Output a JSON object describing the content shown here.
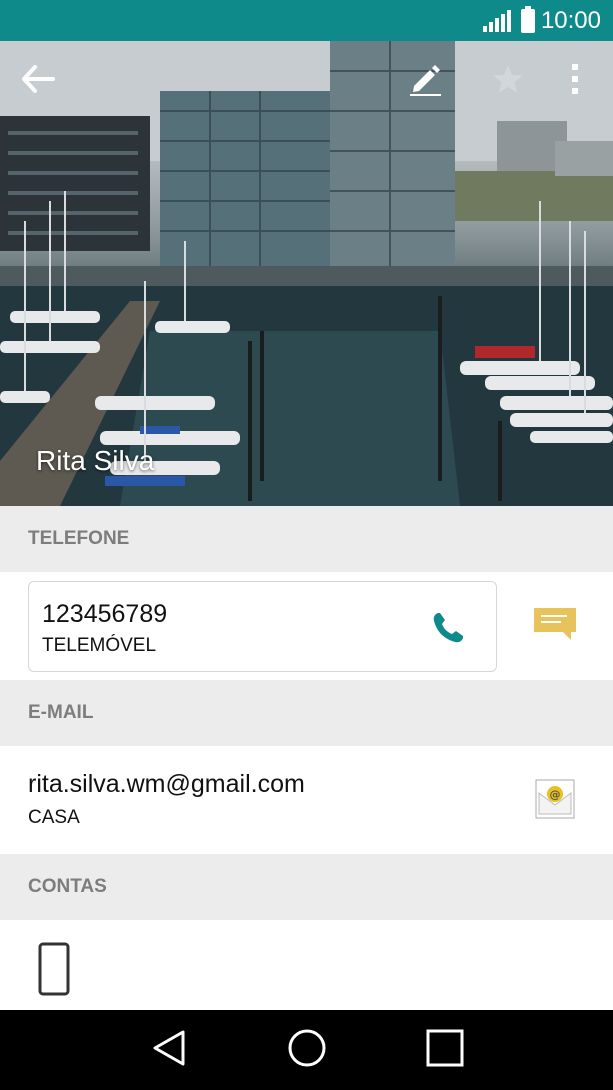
{
  "status_bar": {
    "time": "10:00"
  },
  "contact": {
    "name": "Rita Silva"
  },
  "sections": {
    "phone_header": "TELEFONE",
    "email_header": "E-MAIL",
    "accounts_header": "CONTAS"
  },
  "phone": {
    "number": "123456789",
    "type": "TELEMÓVEL"
  },
  "email": {
    "address": "rita.silva.wm@gmail.com",
    "type": "CASA"
  },
  "icons": {
    "back": "arrow-back-icon",
    "edit": "pencil-icon",
    "favorite": "star-icon",
    "more": "more-vert-icon",
    "call": "phone-icon",
    "message": "message-icon",
    "email": "email-icon",
    "account": "device-phone-icon"
  },
  "colors": {
    "status_bar": "#0e8a8a",
    "call_icon": "#0e8a8a",
    "message_icon": "#e8c25a"
  }
}
